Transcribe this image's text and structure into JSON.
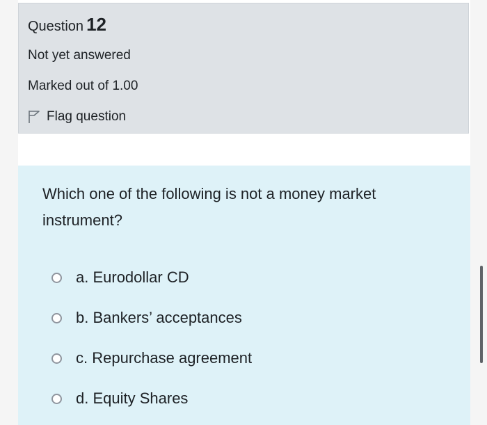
{
  "question_info": {
    "label": "Question",
    "number": "12",
    "state": "Not yet answered",
    "grade": "Marked out of 1.00",
    "flag_label": "Flag question",
    "flag_icon": "flag-icon"
  },
  "question": {
    "text": "Which one of the following is not a money market instrument?",
    "options": [
      {
        "label": "a. Eurodollar CD",
        "selected": false
      },
      {
        "label": "b. Bankers’ acceptances",
        "selected": false
      },
      {
        "label": "c. Repurchase agreement",
        "selected": false
      },
      {
        "label": "d. Equity Shares",
        "selected": false
      }
    ]
  },
  "colors": {
    "info_background": "#dee2e6",
    "content_background": "#def2f8",
    "text": "#1d2125"
  }
}
